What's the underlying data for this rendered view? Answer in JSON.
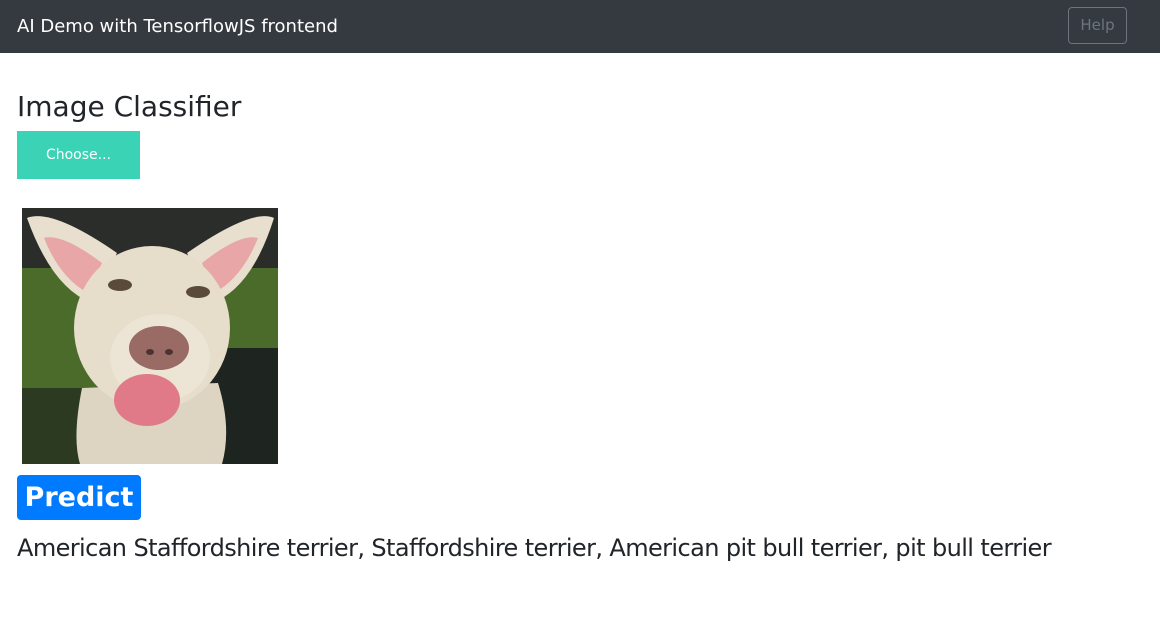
{
  "navbar": {
    "brand": "AI Demo with TensorflowJS frontend",
    "help_label": "Help"
  },
  "main": {
    "title": "Image Classifier",
    "choose_label": "Choose...",
    "predict_label": "Predict",
    "prediction": "American Staffordshire terrier, Staffordshire terrier, American pit bull terrier, pit bull terrier"
  },
  "colors": {
    "navbar_bg": "#343a40",
    "choose_bg": "#3ad3b5",
    "predict_bg": "#007bff"
  }
}
